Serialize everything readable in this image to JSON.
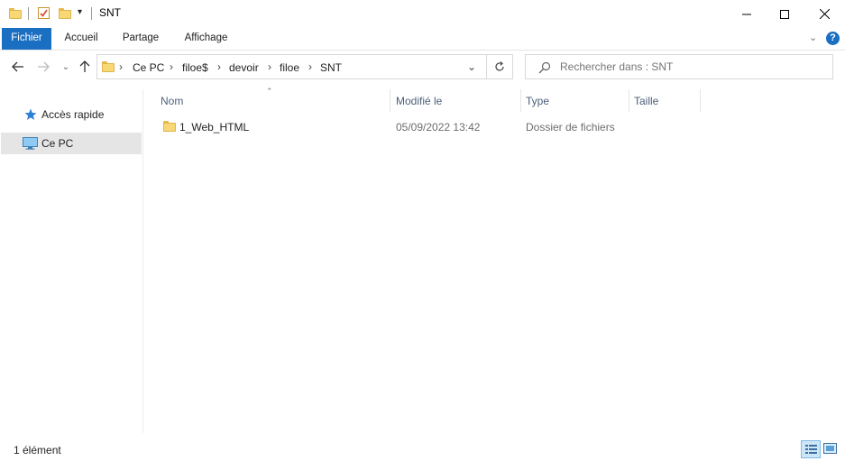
{
  "window": {
    "title": "SNT",
    "controls": {
      "minimize": "—",
      "maximize": "☐",
      "close": "✕"
    }
  },
  "ribbon": {
    "tabs": [
      "Fichier",
      "Accueil",
      "Partage",
      "Affichage"
    ]
  },
  "address": {
    "breadcrumbs": [
      "Ce PC",
      "filoe$",
      "devoir",
      "filoe",
      "SNT"
    ]
  },
  "search": {
    "placeholder": "Rechercher dans : SNT"
  },
  "nav_pane": {
    "items": [
      {
        "label": "Accès rapide",
        "icon": "star-icon"
      },
      {
        "label": "Ce PC",
        "icon": "computer-icon",
        "selected": true
      }
    ]
  },
  "columns": [
    "Nom",
    "Modifié le",
    "Type",
    "Taille"
  ],
  "files": [
    {
      "name": "1_Web_HTML",
      "modified": "05/09/2022 13:42",
      "type": "Dossier de fichiers",
      "size": ""
    }
  ],
  "status": {
    "count": "1 élément"
  },
  "colors": {
    "accent": "#1a6fc2",
    "folder": "#f8d775",
    "selected_bg": "#e5e5e5"
  }
}
